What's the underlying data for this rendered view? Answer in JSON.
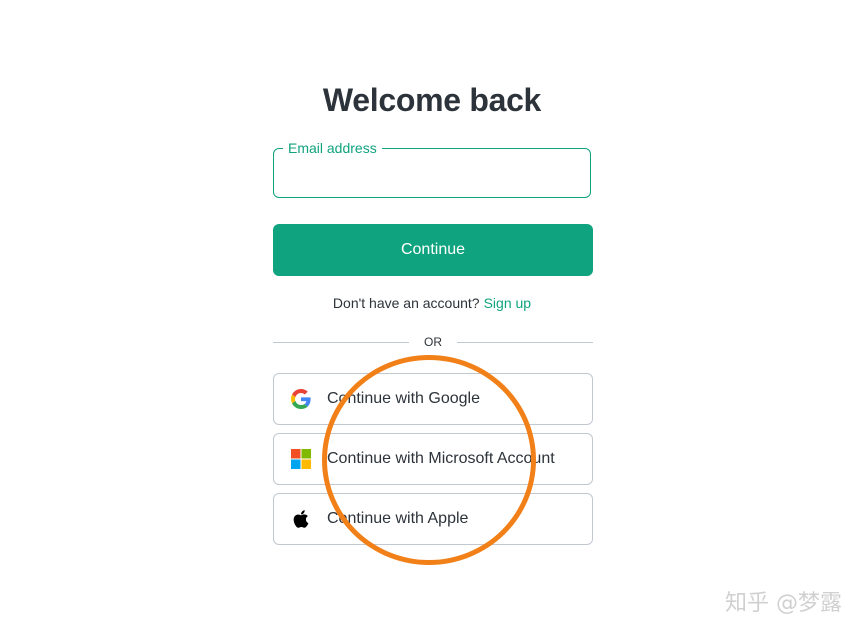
{
  "page": {
    "title": "Welcome back"
  },
  "form": {
    "email_label": "Email address",
    "email_value": "",
    "continue_label": "Continue"
  },
  "signup": {
    "prompt": "Don't have an account?",
    "link_label": "Sign up"
  },
  "divider": {
    "label": "OR"
  },
  "social_buttons": [
    {
      "label": "Continue with Google",
      "icon": "google-icon"
    },
    {
      "label": "Continue with Microsoft Account",
      "icon": "microsoft-icon"
    },
    {
      "label": "Continue with Apple",
      "icon": "apple-icon"
    }
  ],
  "annotation": {
    "color": "#f28019"
  },
  "watermark": {
    "text": "知乎 @梦露"
  },
  "colors": {
    "accent": "#10a37f",
    "text": "#2d333a",
    "border": "#c2c8d0"
  }
}
